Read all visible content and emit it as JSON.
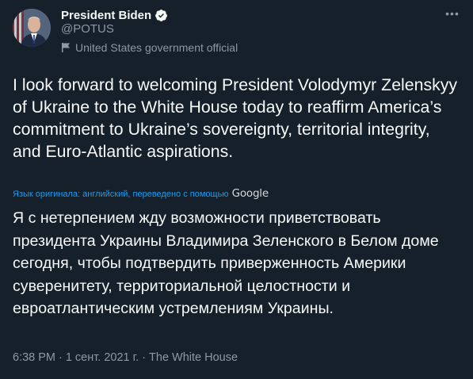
{
  "author": {
    "display_name": "President Biden",
    "handle": "@POTUS",
    "label": "United States government official",
    "verified": true
  },
  "tweet": {
    "text": "I look forward to welcoming President Volodymyr Zelenskyy of Ukraine to the White House today to reaffirm America’s commitment to Ukraine’s sovereignty, territorial integrity, and Euro-Atlantic aspirations.",
    "translation_note": "Язык оригинала: английский, переведено с помощью",
    "translation_provider": "Google",
    "translated_text": "Я с нетерпением жду возможности приветствовать президента Украины Владимира Зеленского в Белом доме сегодня, чтобы подтвердить приверженность Америки суверенитету, территориальной целостности и евроатлантическим устремлениям Украины."
  },
  "meta": {
    "time": "6:38 PM",
    "sep1": "·",
    "date": "1 сент. 2021 г.",
    "sep2": "·",
    "source": "The White House"
  },
  "colors": {
    "background": "#15202b",
    "primary_text": "#f7f9f9",
    "secondary_text": "#8b98a5",
    "accent": "#1d9bf0"
  },
  "icons": {
    "more": "more-horizontal-icon",
    "verified": "verified-badge-icon",
    "label": "flag-icon"
  }
}
